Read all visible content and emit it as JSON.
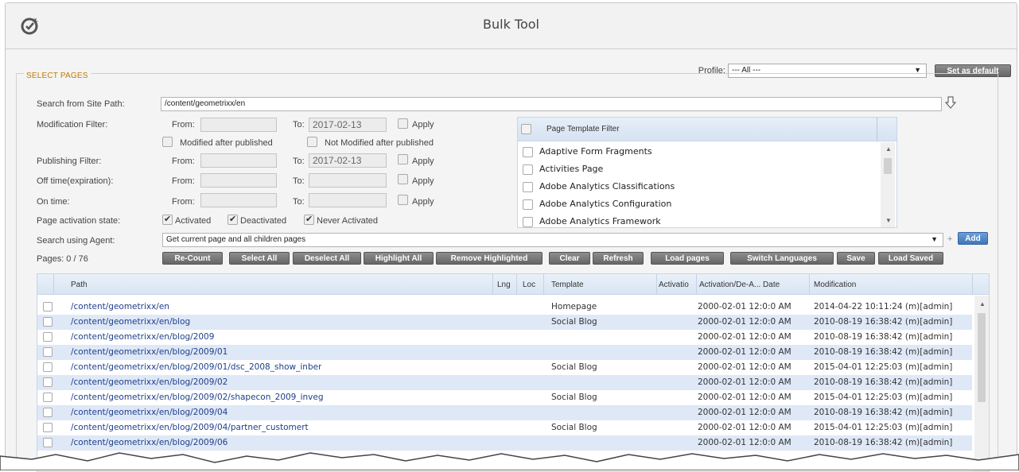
{
  "window": {
    "title": "Bulk Tool"
  },
  "profile": {
    "label": "Profile:",
    "value": "--- All ---",
    "set_default": "Set as default"
  },
  "section": {
    "legend": "SELECT PAGES"
  },
  "form": {
    "site_path_label": "Search from Site Path:",
    "site_path_value": "/content/geometrixx/en",
    "modification_label": "Modification Filter:",
    "publishing_label": "Publishing Filter:",
    "offtime_label": "Off time(expiration):",
    "ontime_label": "On time:",
    "from": "From:",
    "to": "To:",
    "apply": "Apply",
    "mod_to_value": "2017-02-13",
    "pub_to_value": "2017-02-13",
    "modified_after": "Modified after published",
    "not_modified_after": "Not Modified after published",
    "activation_label": "Page activation state:",
    "activated": "Activated",
    "deactivated": "Deactivated",
    "never_activated": "Never Activated",
    "agent_label": "Search using Agent:",
    "agent_value": "Get current page and all children pages",
    "plus": "+",
    "add": "Add",
    "pages_count": "Pages: 0 / 76"
  },
  "template_filter": {
    "header": "Page Template Filter",
    "items": [
      "Adaptive Form Fragments",
      "Activities Page",
      "Adobe Analytics Classifications",
      "Adobe Analytics Configuration",
      "Adobe Analytics Framework"
    ]
  },
  "buttons": {
    "recount": "Re-Count",
    "select_all": "Select All",
    "deselect_all": "Deselect All",
    "highlight_all": "Highlight All",
    "remove_highlighted": "Remove Highlighted",
    "clear": "Clear",
    "refresh": "Refresh",
    "load_pages": "Load pages",
    "switch_languages": "Switch Languages",
    "save": "Save",
    "load_saved": "Load Saved"
  },
  "grid": {
    "columns": [
      "Path",
      "Lng",
      "Loc",
      "Template",
      "Activatio",
      "Activation/De-A... Date",
      "Modification"
    ],
    "rows": [
      {
        "path": "/content/geometrixx/en",
        "template": "Homepage",
        "date": "2000-02-01 12:0:0 AM",
        "mod": "2014-04-22 10:11:24 (m)[admin]"
      },
      {
        "path": "/content/geometrixx/en/blog",
        "template": "Social Blog",
        "date": "2000-02-01 12:0:0 AM",
        "mod": "2010-08-19 16:38:42 (m)[admin]"
      },
      {
        "path": "/content/geometrixx/en/blog/2009",
        "template": "",
        "date": "2000-02-01 12:0:0 AM",
        "mod": "2010-08-19 16:38:42 (m)[admin]"
      },
      {
        "path": "/content/geometrixx/en/blog/2009/01",
        "template": "",
        "date": "2000-02-01 12:0:0 AM",
        "mod": "2010-08-19 16:38:42 (m)[admin]"
      },
      {
        "path": "/content/geometrixx/en/blog/2009/01/dsc_2008_show_inber",
        "template": "Social Blog",
        "date": "2000-02-01 12:0:0 AM",
        "mod": "2015-04-01 12:25:03 (m)[admin]"
      },
      {
        "path": "/content/geometrixx/en/blog/2009/02",
        "template": "",
        "date": "2000-02-01 12:0:0 AM",
        "mod": "2010-08-19 16:38:42 (m)[admin]"
      },
      {
        "path": "/content/geometrixx/en/blog/2009/02/shapecon_2009_inveg",
        "template": "Social Blog",
        "date": "2000-02-01 12:0:0 AM",
        "mod": "2015-04-01 12:25:03 (m)[admin]"
      },
      {
        "path": "/content/geometrixx/en/blog/2009/04",
        "template": "",
        "date": "2000-02-01 12:0:0 AM",
        "mod": "2010-08-19 16:38:42 (m)[admin]"
      },
      {
        "path": "/content/geometrixx/en/blog/2009/04/partner_customert",
        "template": "Social Blog",
        "date": "2000-02-01 12:0:0 AM",
        "mod": "2015-04-01 12:25:03 (m)[admin]"
      },
      {
        "path": "/content/geometrixx/en/blog/2009/06",
        "template": "",
        "date": "2000-02-01 12:0:0 AM",
        "mod": "2010-08-19 16:38:42 (m)[admin]"
      }
    ]
  }
}
